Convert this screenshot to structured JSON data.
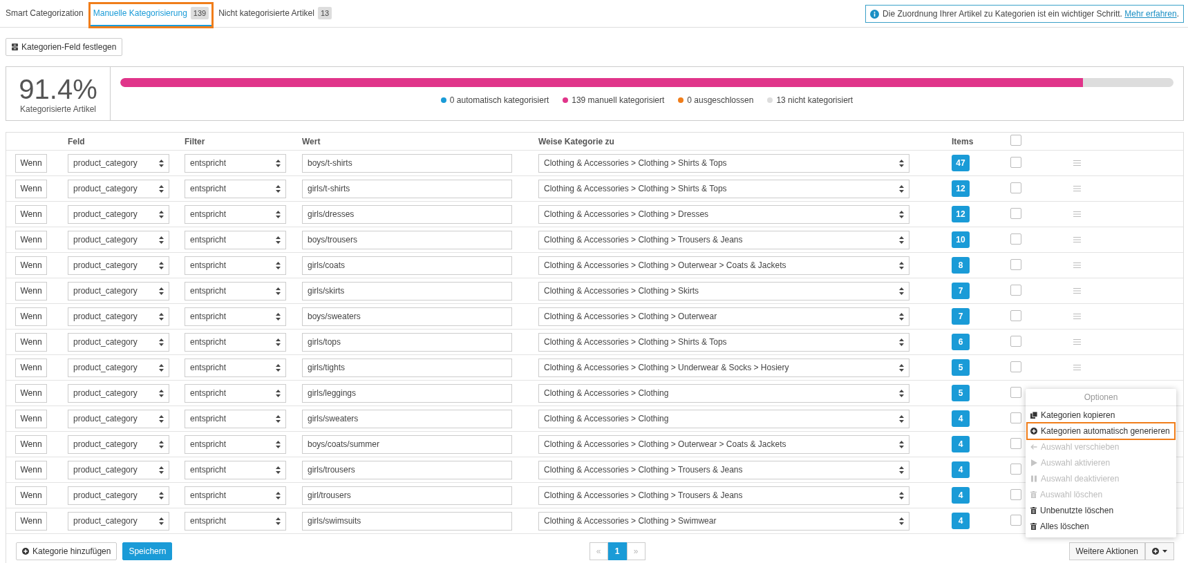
{
  "tabs": [
    {
      "label": "Smart Categorization",
      "selected": false,
      "highlighted": false
    },
    {
      "label": "Manuelle Kategorisierung",
      "count": "139",
      "selected": true,
      "highlighted": true
    },
    {
      "label": "Nicht kategorisierte Artikel",
      "count": "13",
      "selected": false,
      "highlighted": false
    }
  ],
  "info": {
    "text": "Die Zuordnung Ihrer Artikel zu Kategorien ist ein wichtiger Schritt.",
    "link": "Mehr erfahren",
    "end": "."
  },
  "set_field_button": "Kategorien-Feld festlegen",
  "stats": {
    "percent": "91.4%",
    "caption": "Kategorisierte Artikel",
    "level": 0.914,
    "legend": [
      {
        "label": "0 automatisch kategorisiert",
        "color": "#1a9bd7"
      },
      {
        "label": "139 manuell kategorisiert",
        "color": "#e0358a"
      },
      {
        "label": "0 ausgeschlossen",
        "color": "#f07d1a"
      },
      {
        "label": "13 nicht kategorisiert",
        "color": "#dddddd"
      }
    ]
  },
  "table": {
    "columns": [
      "Feld",
      "Filter",
      "Wert",
      "Weise Kategorie zu",
      "Items"
    ],
    "select_all": {
      "checked": false
    },
    "rows": [
      {
        "condition": "Wenn",
        "field": "product_category",
        "filter": "entspricht",
        "value": "boys/t-shirts",
        "category": "Clothing & Accessories > Clothing > Shirts & Tops",
        "items": "47",
        "checked": false
      },
      {
        "condition": "Wenn",
        "field": "product_category",
        "filter": "entspricht",
        "value": "girls/t-shirts",
        "category": "Clothing & Accessories > Clothing > Shirts & Tops",
        "items": "12",
        "checked": false
      },
      {
        "condition": "Wenn",
        "field": "product_category",
        "filter": "entspricht",
        "value": "girls/dresses",
        "category": "Clothing & Accessories > Clothing > Dresses",
        "items": "12",
        "checked": false
      },
      {
        "condition": "Wenn",
        "field": "product_category",
        "filter": "entspricht",
        "value": "boys/trousers",
        "category": "Clothing & Accessories > Clothing > Trousers & Jeans",
        "items": "10",
        "checked": false
      },
      {
        "condition": "Wenn",
        "field": "product_category",
        "filter": "entspricht",
        "value": "girls/coats",
        "category": "Clothing & Accessories > Clothing > Outerwear > Coats & Jackets",
        "items": "8",
        "checked": false
      },
      {
        "condition": "Wenn",
        "field": "product_category",
        "filter": "entspricht",
        "value": "girls/skirts",
        "category": "Clothing & Accessories > Clothing > Skirts",
        "items": "7",
        "checked": false
      },
      {
        "condition": "Wenn",
        "field": "product_category",
        "filter": "entspricht",
        "value": "boys/sweaters",
        "category": "Clothing & Accessories > Clothing > Outerwear",
        "items": "7",
        "checked": false
      },
      {
        "condition": "Wenn",
        "field": "product_category",
        "filter": "entspricht",
        "value": "girls/tops",
        "category": "Clothing & Accessories > Clothing > Shirts & Tops",
        "items": "6",
        "checked": false
      },
      {
        "condition": "Wenn",
        "field": "product_category",
        "filter": "entspricht",
        "value": "girls/tights",
        "category": "Clothing & Accessories > Clothing > Underwear & Socks > Hosiery",
        "items": "5",
        "checked": false
      },
      {
        "condition": "Wenn",
        "field": "product_category",
        "filter": "entspricht",
        "value": "girls/leggings",
        "category": "Clothing & Accessories > Clothing",
        "items": "5",
        "checked": false
      },
      {
        "condition": "Wenn",
        "field": "product_category",
        "filter": "entspricht",
        "value": "girls/sweaters",
        "category": "Clothing & Accessories > Clothing",
        "items": "4",
        "checked": false
      },
      {
        "condition": "Wenn",
        "field": "product_category",
        "filter": "entspricht",
        "value": "boys/coats/summer",
        "category": "Clothing & Accessories > Clothing > Outerwear > Coats & Jackets",
        "items": "4",
        "checked": false
      },
      {
        "condition": "Wenn",
        "field": "product_category",
        "filter": "entspricht",
        "value": "girls/trousers",
        "category": "Clothing & Accessories > Clothing > Trousers & Jeans",
        "items": "4",
        "checked": false
      },
      {
        "condition": "Wenn",
        "field": "product_category",
        "filter": "entspricht",
        "value": "girl/trousers",
        "category": "Clothing & Accessories > Clothing > Trousers & Jeans",
        "items": "4",
        "checked": false
      },
      {
        "condition": "Wenn",
        "field": "product_category",
        "filter": "entspricht",
        "value": "girls/swimsuits",
        "category": "Clothing & Accessories > Clothing > Swimwear",
        "items": "4",
        "checked": false
      }
    ]
  },
  "footer": {
    "add_button": "Kategorie hinzufügen",
    "save_button": "Speichern",
    "pagination": [
      {
        "label": "«",
        "selected": false,
        "disabled": true
      },
      {
        "label": "1",
        "selected": true,
        "disabled": false
      },
      {
        "label": "»",
        "selected": false,
        "disabled": true
      }
    ],
    "more_actions": "Weitere Aktionen"
  },
  "options_menu": {
    "title": "Optionen",
    "items": [
      {
        "label": "Kategorien kopieren",
        "disabled": false,
        "highlighted": false
      },
      {
        "label": "Kategorien automatisch generieren",
        "disabled": false,
        "highlighted": true
      },
      {
        "label": "Auswahl verschieben",
        "disabled": true,
        "highlighted": false
      },
      {
        "label": "Auswahl aktivieren",
        "disabled": true,
        "highlighted": false
      },
      {
        "label": "Auswahl deaktivieren",
        "disabled": true,
        "highlighted": false
      },
      {
        "label": "Auswahl löschen",
        "disabled": true,
        "highlighted": false
      },
      {
        "label": "Unbenutzte löschen",
        "disabled": false,
        "highlighted": false
      },
      {
        "label": "Alles löschen",
        "disabled": false,
        "highlighted": false
      }
    ]
  }
}
